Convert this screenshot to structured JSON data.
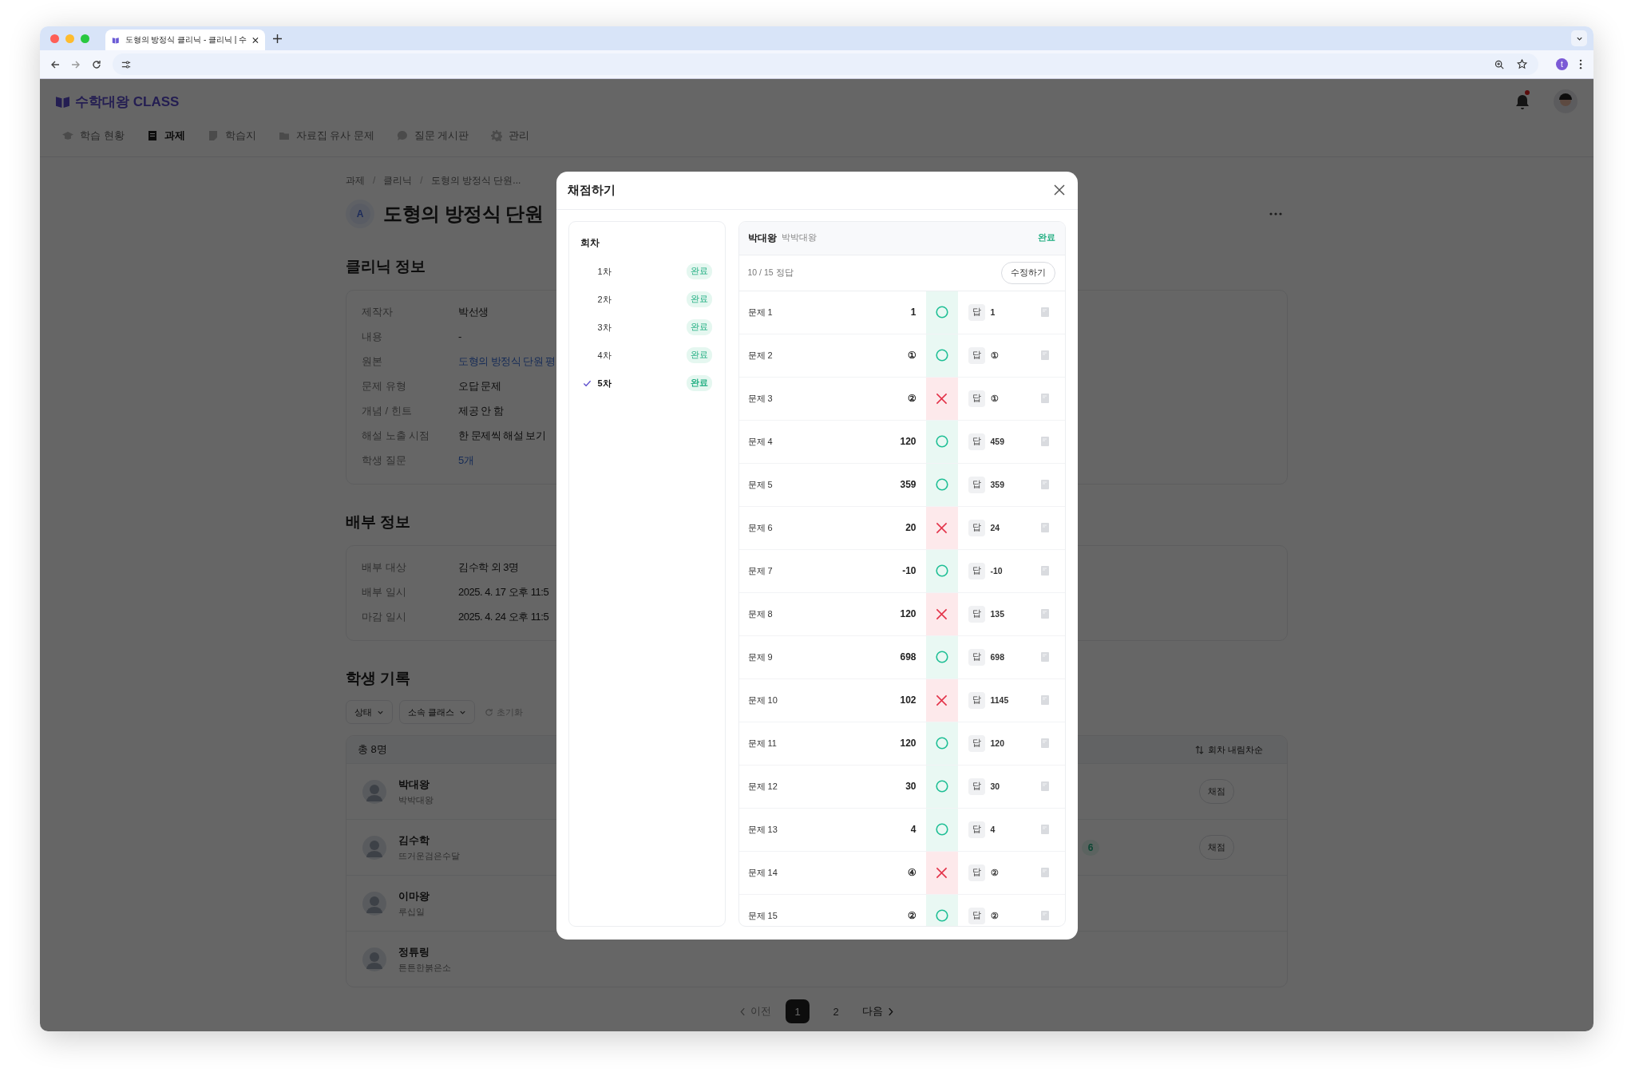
{
  "browser": {
    "tab_title": "도형의 방정식 클리닉 - 클리닉 | 수",
    "profile_initial": "t"
  },
  "app": {
    "logo": "수학대왕 CLASS",
    "unread": true,
    "nav": [
      {
        "label": "학습 현황",
        "selected": false
      },
      {
        "label": "과제",
        "selected": true
      },
      {
        "label": "학습지",
        "selected": false
      },
      {
        "label": "자료집 유사 문제",
        "selected": false
      },
      {
        "label": "질문 게시판",
        "selected": false
      },
      {
        "label": "관리",
        "selected": false
      }
    ]
  },
  "page": {
    "breadcrumbs": [
      {
        "kind": "link",
        "text": "과제"
      },
      {
        "kind": "separator",
        "text": "/"
      },
      {
        "kind": "link",
        "text": "클리닉"
      },
      {
        "kind": "separator",
        "text": "/"
      },
      {
        "kind": "link",
        "text": "도형의 방정식 단원..."
      }
    ],
    "avatar_letter": "A",
    "title": "도형의 방정식 단원"
  },
  "clinic_info": {
    "heading": "클리닉 정보",
    "rows": [
      {
        "label": "제작자",
        "value": "박선생",
        "link": false
      },
      {
        "label": "내용",
        "value": "-",
        "link": false
      },
      {
        "label": "원본",
        "value": "도형의 방정식 단원 평",
        "link": true
      },
      {
        "label": "문제 유형",
        "value": "오답 문제",
        "link": false
      },
      {
        "label": "개념 / 힌트",
        "value": "제공 안 함",
        "link": false
      },
      {
        "label": "해설 노출 시점",
        "value": "한 문제씩 해설 보기",
        "link": false
      },
      {
        "label": "학생 질문",
        "value": "5개",
        "link": true
      }
    ]
  },
  "distribution_info": {
    "heading": "배부 정보",
    "rows": [
      {
        "label": "배부 대상",
        "value": "김수학 외 3명",
        "link": false
      },
      {
        "label": "배부 일시",
        "value": "2025. 4. 17 오후 11:5",
        "link": false
      },
      {
        "label": "마감 일시",
        "value": "2025. 4. 24 오후 11:5",
        "link": false
      }
    ]
  },
  "student_records": {
    "heading": "학생 기록",
    "filters": [
      "상태",
      "소속 클래스"
    ],
    "reset": "초기화",
    "total": "총 8명",
    "sort": "회차 내림차순",
    "rows": [
      {
        "name": "박대왕",
        "nickname": "박박대왕",
        "action": "채점"
      },
      {
        "name": "김수학",
        "nickname": "뜨거운검은수달",
        "badge": "6",
        "action": "채점"
      },
      {
        "name": "이마왕",
        "nickname": "루십일"
      },
      {
        "name": "정튜링",
        "nickname": "튼튼한붉은소"
      }
    ]
  },
  "pagination": {
    "prev": "이전",
    "pages": [
      {
        "label": "1",
        "selected": true
      },
      {
        "label": "2",
        "selected": false
      }
    ],
    "next": "다음"
  },
  "modal": {
    "title": "채점하기",
    "rounds_heading": "회차",
    "rounds": [
      {
        "label": "1차",
        "status": "완료",
        "selected": false
      },
      {
        "label": "2차",
        "status": "완료",
        "selected": false
      },
      {
        "label": "3차",
        "status": "완료",
        "selected": false
      },
      {
        "label": "4차",
        "status": "완료",
        "selected": false
      },
      {
        "label": "5차",
        "status": "완료",
        "selected": true
      }
    ],
    "student": {
      "name": "박대왕",
      "nickname": "박박대왕",
      "status": "완료"
    },
    "score": "10 / 15 정답",
    "edit_button": "수정하기",
    "problems": [
      {
        "label": "문제 1",
        "response": "1",
        "correct": true,
        "answer_tag": "답",
        "answer": "1"
      },
      {
        "label": "문제 2",
        "response": "①",
        "correct": true,
        "answer_tag": "답",
        "answer": "①"
      },
      {
        "label": "문제 3",
        "response": "②",
        "correct": false,
        "answer_tag": "답",
        "answer": "①"
      },
      {
        "label": "문제 4",
        "response": "120",
        "correct": true,
        "answer_tag": "답",
        "answer": "459"
      },
      {
        "label": "문제 5",
        "response": "359",
        "correct": true,
        "answer_tag": "답",
        "answer": "359"
      },
      {
        "label": "문제 6",
        "response": "20",
        "correct": false,
        "answer_tag": "답",
        "answer": "24"
      },
      {
        "label": "문제 7",
        "response": "-10",
        "correct": true,
        "answer_tag": "답",
        "answer": "-10"
      },
      {
        "label": "문제 8",
        "response": "120",
        "correct": false,
        "answer_tag": "답",
        "answer": "135"
      },
      {
        "label": "문제 9",
        "response": "698",
        "correct": true,
        "answer_tag": "답",
        "answer": "698"
      },
      {
        "label": "문제 10",
        "response": "102",
        "correct": false,
        "answer_tag": "답",
        "answer": "1145"
      },
      {
        "label": "문제 11",
        "response": "120",
        "correct": true,
        "answer_tag": "답",
        "answer": "120"
      },
      {
        "label": "문제 12",
        "response": "30",
        "correct": true,
        "answer_tag": "답",
        "answer": "30"
      },
      {
        "label": "문제 13",
        "response": "4",
        "correct": true,
        "answer_tag": "답",
        "answer": "4"
      },
      {
        "label": "문제 14",
        "response": "④",
        "correct": false,
        "answer_tag": "답",
        "answer": "②"
      },
      {
        "label": "문제 15",
        "response": "②",
        "correct": true,
        "answer_tag": "답",
        "answer": "②"
      }
    ]
  }
}
